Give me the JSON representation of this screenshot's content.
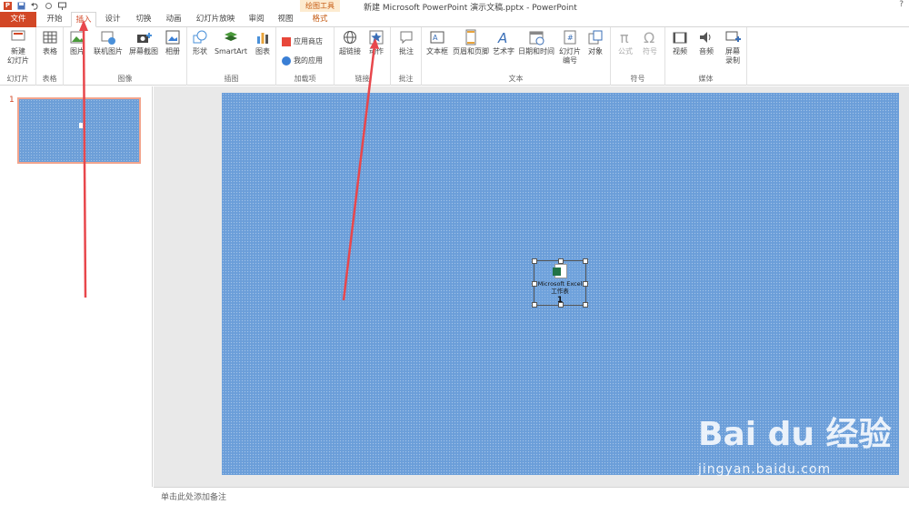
{
  "window": {
    "title": "新建 Microsoft PowerPoint 演示文稿.pptx - PowerPoint",
    "context_tools": "绘图工具",
    "help": "?"
  },
  "tabs": [
    "文件",
    "开始",
    "插入",
    "设计",
    "切换",
    "动画",
    "幻灯片放映",
    "审阅",
    "视图",
    "格式"
  ],
  "ribbon": {
    "groups": {
      "slides": "幻灯片",
      "tables": "表格",
      "images": "图像",
      "illustrations": "插图",
      "addins": "加载项",
      "links": "链接",
      "comments": "批注",
      "text": "文本",
      "symbols": "符号",
      "media": "媒体"
    },
    "buttons": {
      "new_slide_1": "新建",
      "new_slide_2": "幻灯片",
      "table": "表格",
      "picture": "图片",
      "online_picture": "联机图片",
      "screenshot": "屏幕截图",
      "album": "相册",
      "shapes": "形状",
      "smartart": "SmartArt",
      "chart": "图表",
      "store": "应用商店",
      "my_apps": "我的应用",
      "hyperlink": "超链接",
      "action": "动作",
      "comment": "批注",
      "textbox": "文本框",
      "header_footer": "页眉和页脚",
      "wordart": "艺术字",
      "datetime": "日期和时间",
      "slide_number_1": "幻灯片",
      "slide_number_2": "编号",
      "object": "对象",
      "equation": "公式",
      "symbol": "符号",
      "video": "视频",
      "audio": "音频",
      "screen_rec_1": "屏幕",
      "screen_rec_2": "录制"
    }
  },
  "slides_pane": {
    "slide_number": "1"
  },
  "slide": {
    "embedded_object": {
      "label_1": "Microsoft Excel",
      "label_2": "工作表",
      "number": "1"
    }
  },
  "notes": {
    "placeholder": "单击此处添加备注"
  },
  "watermark": {
    "brand": "Bai du 经验",
    "url": "jingyan.baidu.com"
  },
  "colors": {
    "accent": "#d24726",
    "slide_bg": "#6b9ed9",
    "arrow": "#e8474c"
  }
}
